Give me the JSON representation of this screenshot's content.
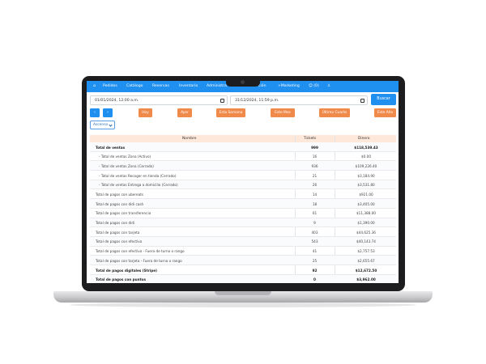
{
  "nav": {
    "home": "⌂",
    "items": [
      "Pedidos",
      "Catálogo",
      "Reservas",
      "Inventario",
      "Administra",
      "ción",
      "+Marketing",
      "☺ (0)",
      "♙"
    ]
  },
  "filters": {
    "start": "01/01/2024, 12:00 a.m.",
    "end": "31/12/2024, 11:59 p.m.",
    "search_label": "Buscar",
    "prev_label": "‹",
    "next_label": "›",
    "periods": [
      "Hoy",
      "Ayer",
      "Esta Semana",
      "Este Mes",
      "Último Cuarto",
      "Este Año"
    ],
    "sort_label": "Ascenso"
  },
  "table": {
    "headers": [
      "Nombre",
      "Tickets",
      "Dinero"
    ],
    "rows": [
      {
        "name": "Total de ventas",
        "tickets": "999",
        "money": "$118,539.43",
        "bold": true
      },
      {
        "name": "- Total de ventas Zona (Activo)",
        "tickets": "16",
        "money": "$0.00",
        "indent": true
      },
      {
        "name": "- Total de ventas Zona (Cerrado)",
        "tickets": "936",
        "money": "$109,226.40",
        "indent": true
      },
      {
        "name": "- Total de ventas Recoger en tienda (Cerrado)",
        "tickets": "21",
        "money": "$3,184.90",
        "indent": true
      },
      {
        "name": "- Total de ventas Entrega a domicilio (Cerrado)",
        "tickets": "26",
        "money": "$3,531.80",
        "indent": true
      },
      {
        "name": "Total de pagos con ubereats",
        "tickets": "14",
        "money": "$921.00"
      },
      {
        "name": "Total de pagos con didi cash",
        "tickets": "18",
        "money": "$3,405.00"
      },
      {
        "name": "Total de pagos con transferencia",
        "tickets": "61",
        "money": "$11,388.00"
      },
      {
        "name": "Total de pagos con didi",
        "tickets": "9",
        "money": "$1,390.00"
      },
      {
        "name": "Total de pagos con tarjeta",
        "tickets": "403",
        "money": "$44,625.36"
      },
      {
        "name": "Total de pagos con efectivo",
        "tickets": "543",
        "money": "$40,143.74"
      },
      {
        "name": "Total de pagos con efectivo - Fuera de turno o rango",
        "tickets": "41",
        "money": "$2,757.53"
      },
      {
        "name": "Total de pagos con tarjeta - Fuera de turno o rango",
        "tickets": "25",
        "money": "$2,655.67"
      },
      {
        "name": "Total de pagos digitales (Stripe)",
        "tickets": "92",
        "money": "$12,672.50",
        "bold": true
      },
      {
        "name": "Total de pagos con puntos",
        "tickets": "0",
        "money": "$3,962.00",
        "bold": true
      }
    ]
  }
}
